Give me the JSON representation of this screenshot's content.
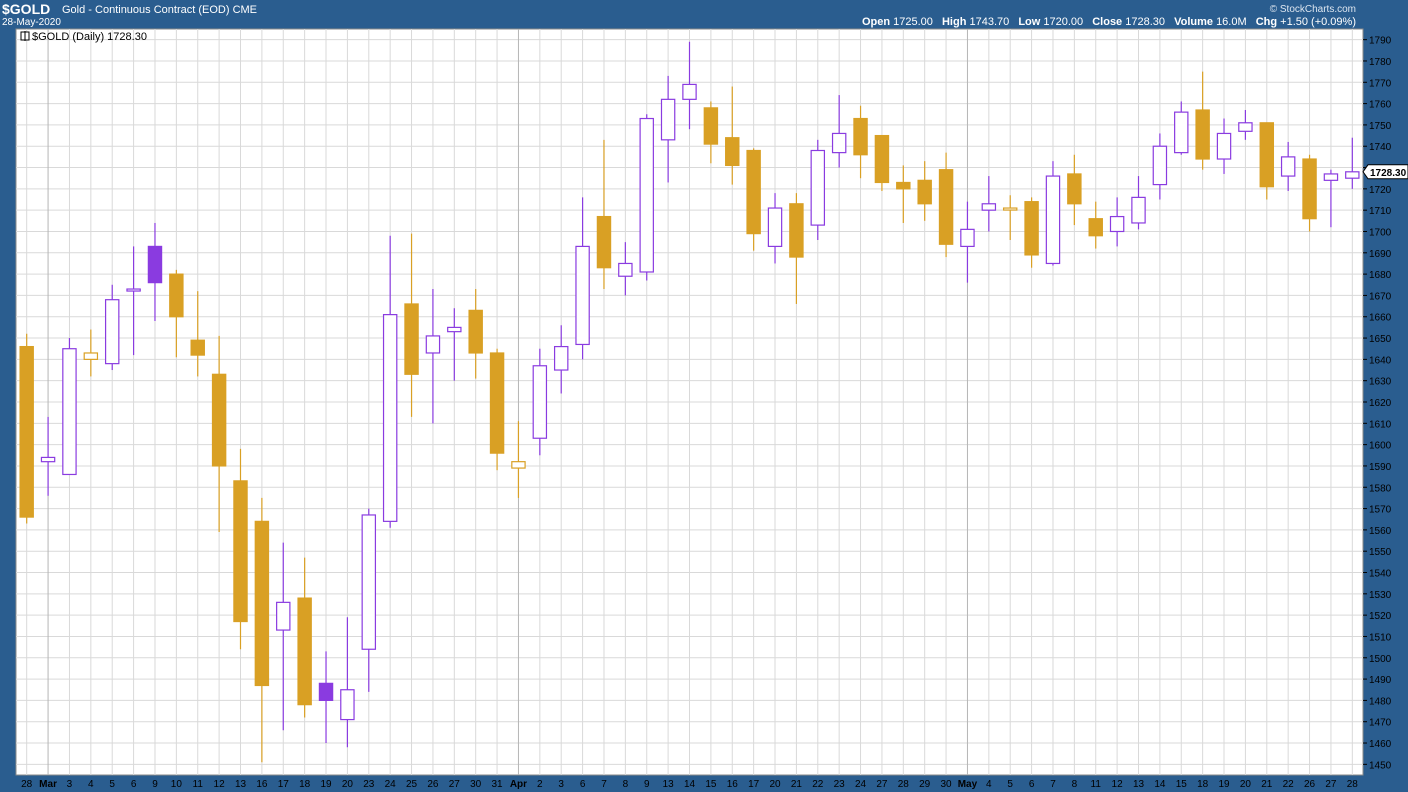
{
  "header": {
    "symbol": "$GOLD",
    "description": "Gold - Continuous Contract (EOD)",
    "exchange": "CME",
    "date": "28-May-2020",
    "brand": "© StockCharts.com",
    "open_label": "Open",
    "open_value": "1725.00",
    "high_label": "High",
    "high_value": "1743.70",
    "low_label": "Low",
    "low_value": "1720.00",
    "close_label": "Close",
    "close_value": "1728.30",
    "volume_label": "Volume",
    "volume_value": "16.0M",
    "chg_label": "Chg",
    "chg_value": "+1.50 (+0.09%)"
  },
  "legend": {
    "text": "$GOLD (Daily) 1728.30"
  },
  "last_price_tag": "1728.30",
  "colors": {
    "up": "#8a3be0",
    "down": "#d9a024",
    "background": "#2a5d8f",
    "plot": "#ffffff",
    "grid": "#d9d9d9"
  },
  "chart_data": {
    "type": "candlestick",
    "ylim": [
      1445,
      1795
    ],
    "y_ticks": [
      1450,
      1460,
      1470,
      1480,
      1490,
      1500,
      1510,
      1520,
      1530,
      1540,
      1550,
      1560,
      1570,
      1580,
      1590,
      1600,
      1610,
      1620,
      1630,
      1640,
      1650,
      1660,
      1670,
      1680,
      1690,
      1700,
      1710,
      1720,
      1730,
      1740,
      1750,
      1760,
      1770,
      1780,
      1790
    ],
    "x_labels": [
      "28",
      "Mar",
      "3",
      "4",
      "5",
      "6",
      "9",
      "10",
      "11",
      "12",
      "13",
      "16",
      "17",
      "18",
      "19",
      "20",
      "23",
      "24",
      "25",
      "26",
      "27",
      "30",
      "31",
      "Apr",
      "2",
      "3",
      "6",
      "7",
      "8",
      "9",
      "13",
      "14",
      "15",
      "16",
      "17",
      "20",
      "21",
      "22",
      "23",
      "24",
      "27",
      "28",
      "29",
      "30",
      "May",
      "4",
      "5",
      "6",
      "7",
      "8",
      "11",
      "12",
      "13",
      "14",
      "15",
      "18",
      "19",
      "20",
      "21",
      "22",
      "26",
      "27",
      "28"
    ],
    "month_separators": [
      1,
      23,
      44
    ],
    "candles": [
      {
        "o": 1566,
        "h": 1652,
        "l": 1563,
        "c": 1646,
        "color": "down",
        "filled": true
      },
      {
        "o": 1592,
        "h": 1613,
        "l": 1576,
        "c": 1594,
        "color": "up",
        "filled": false
      },
      {
        "o": 1586,
        "h": 1650,
        "l": 1586,
        "c": 1645,
        "color": "up",
        "filled": false
      },
      {
        "o": 1643,
        "h": 1654,
        "l": 1632,
        "c": 1640,
        "color": "down",
        "filled": false
      },
      {
        "o": 1638,
        "h": 1675,
        "l": 1635,
        "c": 1668,
        "color": "up",
        "filled": false
      },
      {
        "o": 1673,
        "h": 1693,
        "l": 1642,
        "c": 1673,
        "color": "up",
        "filled": false
      },
      {
        "o": 1676,
        "h": 1704,
        "l": 1658,
        "c": 1693,
        "color": "up",
        "filled": true
      },
      {
        "o": 1680,
        "h": 1682,
        "l": 1641,
        "c": 1660,
        "color": "down",
        "filled": true
      },
      {
        "o": 1649,
        "h": 1672,
        "l": 1632,
        "c": 1642,
        "color": "down",
        "filled": true
      },
      {
        "o": 1633,
        "h": 1651,
        "l": 1559,
        "c": 1590,
        "color": "down",
        "filled": true
      },
      {
        "o": 1583,
        "h": 1598,
        "l": 1504,
        "c": 1517,
        "color": "down",
        "filled": true
      },
      {
        "o": 1564,
        "h": 1575,
        "l": 1451,
        "c": 1487,
        "color": "down",
        "filled": true
      },
      {
        "o": 1513,
        "h": 1554,
        "l": 1466,
        "c": 1526,
        "color": "up",
        "filled": false
      },
      {
        "o": 1528,
        "h": 1547,
        "l": 1472,
        "c": 1478,
        "color": "down",
        "filled": true
      },
      {
        "o": 1480,
        "h": 1503,
        "l": 1460,
        "c": 1488,
        "color": "up",
        "filled": true
      },
      {
        "o": 1471,
        "h": 1519,
        "l": 1458,
        "c": 1485,
        "color": "up",
        "filled": false
      },
      {
        "o": 1504,
        "h": 1570,
        "l": 1484,
        "c": 1567,
        "color": "up",
        "filled": false
      },
      {
        "o": 1564,
        "h": 1698,
        "l": 1561,
        "c": 1661,
        "color": "up",
        "filled": false
      },
      {
        "o": 1666,
        "h": 1699,
        "l": 1613,
        "c": 1633,
        "color": "down",
        "filled": true
      },
      {
        "o": 1643,
        "h": 1673,
        "l": 1610,
        "c": 1651,
        "color": "up",
        "filled": false
      },
      {
        "o": 1653,
        "h": 1664,
        "l": 1630,
        "c": 1655,
        "color": "up",
        "filled": false
      },
      {
        "o": 1663,
        "h": 1673,
        "l": 1631,
        "c": 1643,
        "color": "down",
        "filled": true
      },
      {
        "o": 1643,
        "h": 1645,
        "l": 1588,
        "c": 1596,
        "color": "down",
        "filled": true
      },
      {
        "o": 1592,
        "h": 1611,
        "l": 1575,
        "c": 1589,
        "color": "down",
        "filled": false
      },
      {
        "o": 1603,
        "h": 1645,
        "l": 1595,
        "c": 1637,
        "color": "up",
        "filled": false
      },
      {
        "o": 1635,
        "h": 1656,
        "l": 1624,
        "c": 1646,
        "color": "up",
        "filled": false
      },
      {
        "o": 1647,
        "h": 1716,
        "l": 1640,
        "c": 1693,
        "color": "up",
        "filled": false
      },
      {
        "o": 1707,
        "h": 1743,
        "l": 1673,
        "c": 1683,
        "color": "down",
        "filled": true
      },
      {
        "o": 1679,
        "h": 1695,
        "l": 1670,
        "c": 1685,
        "color": "up",
        "filled": false
      },
      {
        "o": 1681,
        "h": 1755,
        "l": 1677,
        "c": 1753,
        "color": "up",
        "filled": false
      },
      {
        "o": 1743,
        "h": 1773,
        "l": 1723,
        "c": 1762,
        "color": "up",
        "filled": false
      },
      {
        "o": 1762,
        "h": 1789,
        "l": 1748,
        "c": 1769,
        "color": "up",
        "filled": false
      },
      {
        "o": 1758,
        "h": 1761,
        "l": 1732,
        "c": 1741,
        "color": "down",
        "filled": true
      },
      {
        "o": 1744,
        "h": 1768,
        "l": 1722,
        "c": 1731,
        "color": "down",
        "filled": true
      },
      {
        "o": 1738,
        "h": 1739,
        "l": 1691,
        "c": 1699,
        "color": "down",
        "filled": true
      },
      {
        "o": 1693,
        "h": 1718,
        "l": 1685,
        "c": 1711,
        "color": "up",
        "filled": false
      },
      {
        "o": 1713,
        "h": 1718,
        "l": 1666,
        "c": 1688,
        "color": "down",
        "filled": true
      },
      {
        "o": 1703,
        "h": 1743,
        "l": 1696,
        "c": 1738,
        "color": "up",
        "filled": false
      },
      {
        "o": 1737,
        "h": 1764,
        "l": 1730,
        "c": 1746,
        "color": "up",
        "filled": false
      },
      {
        "o": 1753,
        "h": 1759,
        "l": 1725,
        "c": 1736,
        "color": "down",
        "filled": true
      },
      {
        "o": 1745,
        "h": 1745,
        "l": 1719,
        "c": 1723,
        "color": "down",
        "filled": true
      },
      {
        "o": 1723,
        "h": 1731,
        "l": 1704,
        "c": 1720,
        "color": "down",
        "filled": true
      },
      {
        "o": 1724,
        "h": 1733,
        "l": 1705,
        "c": 1713,
        "color": "down",
        "filled": true
      },
      {
        "o": 1729,
        "h": 1737,
        "l": 1688,
        "c": 1694,
        "color": "down",
        "filled": true
      },
      {
        "o": 1693,
        "h": 1714,
        "l": 1676,
        "c": 1701,
        "color": "up",
        "filled": false
      },
      {
        "o": 1710,
        "h": 1726,
        "l": 1700,
        "c": 1713,
        "color": "up",
        "filled": false
      },
      {
        "o": 1711,
        "h": 1717,
        "l": 1696,
        "c": 1711,
        "color": "down",
        "filled": false
      },
      {
        "o": 1714,
        "h": 1716,
        "l": 1683,
        "c": 1689,
        "color": "down",
        "filled": true
      },
      {
        "o": 1685,
        "h": 1733,
        "l": 1684,
        "c": 1726,
        "color": "up",
        "filled": false
      },
      {
        "o": 1727,
        "h": 1736,
        "l": 1703,
        "c": 1713,
        "color": "down",
        "filled": true
      },
      {
        "o": 1706,
        "h": 1714,
        "l": 1692,
        "c": 1698,
        "color": "down",
        "filled": true
      },
      {
        "o": 1700,
        "h": 1716,
        "l": 1693,
        "c": 1707,
        "color": "up",
        "filled": false
      },
      {
        "o": 1704,
        "h": 1726,
        "l": 1701,
        "c": 1716,
        "color": "up",
        "filled": false
      },
      {
        "o": 1722,
        "h": 1746,
        "l": 1715,
        "c": 1740,
        "color": "up",
        "filled": false
      },
      {
        "o": 1737,
        "h": 1761,
        "l": 1736,
        "c": 1756,
        "color": "up",
        "filled": false
      },
      {
        "o": 1757,
        "h": 1775,
        "l": 1729,
        "c": 1734,
        "color": "down",
        "filled": true
      },
      {
        "o": 1734,
        "h": 1753,
        "l": 1727,
        "c": 1746,
        "color": "up",
        "filled": false
      },
      {
        "o": 1747,
        "h": 1757,
        "l": 1743,
        "c": 1751,
        "color": "up",
        "filled": false
      },
      {
        "o": 1751,
        "h": 1751,
        "l": 1715,
        "c": 1721,
        "color": "down",
        "filled": true
      },
      {
        "o": 1726,
        "h": 1742,
        "l": 1719,
        "c": 1735,
        "color": "up",
        "filled": false
      },
      {
        "o": 1734,
        "h": 1736,
        "l": 1700,
        "c": 1706,
        "color": "down",
        "filled": true
      },
      {
        "o": 1724,
        "h": 1729,
        "l": 1702,
        "c": 1727,
        "color": "up",
        "filled": false
      },
      {
        "o": 1725,
        "h": 1744,
        "l": 1720,
        "c": 1728,
        "color": "up",
        "filled": false
      }
    ]
  }
}
